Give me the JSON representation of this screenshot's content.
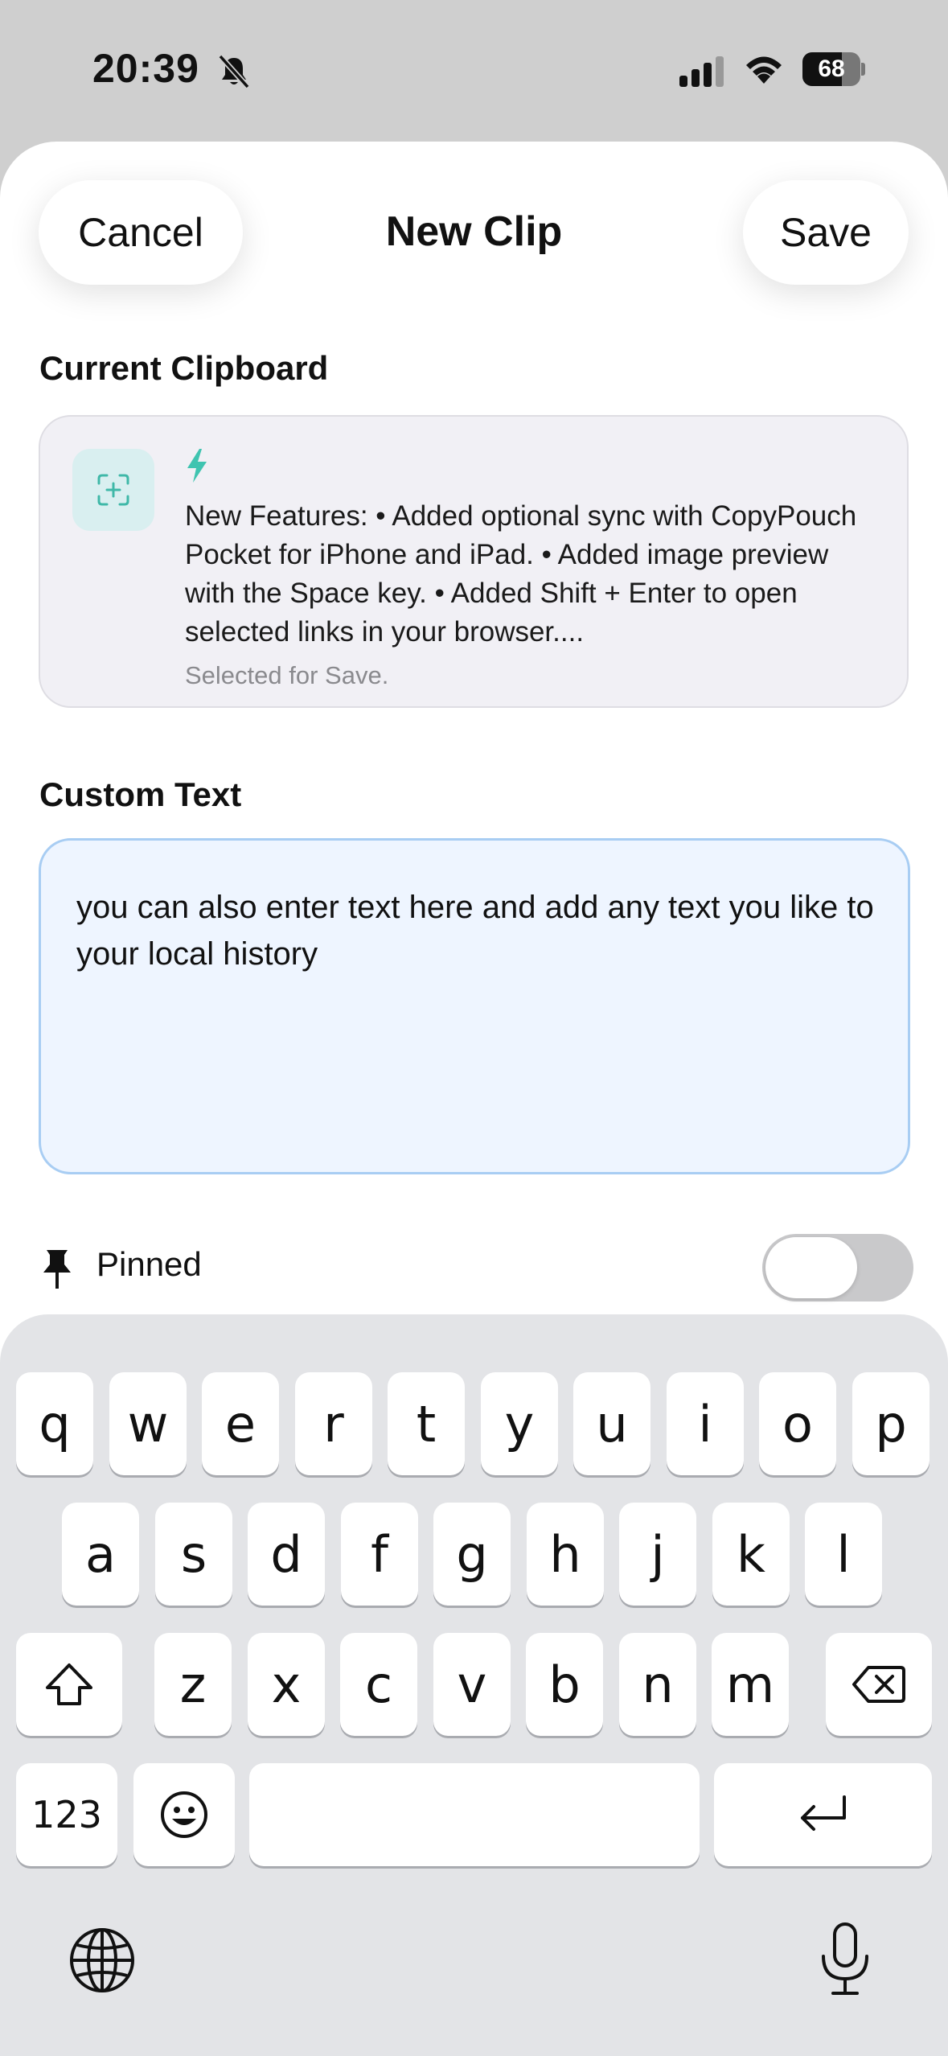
{
  "status_bar": {
    "time": "20:39",
    "battery": "68",
    "battery_level": 0.68,
    "icons": [
      "bell-slash-icon",
      "cellular-signal-icon",
      "wifi-icon",
      "battery-icon"
    ]
  },
  "header": {
    "cancel_label": "Cancel",
    "title": "New Clip",
    "save_label": "Save"
  },
  "clipboard": {
    "section_label": "Current Clipboard",
    "icon": "scan-add-icon",
    "type_icon": "bolt-icon",
    "text": "New Features: • Added optional sync with CopyPouch Pocket for iPhone and iPad. • Added image preview with the Space key. • Added Shift + Enter to open selected links in your browser....",
    "status": "Selected for Save."
  },
  "custom_text": {
    "section_label": "Custom Text",
    "value": "you can also enter text here and add any text you like to your local history"
  },
  "pinned": {
    "label": "Pinned",
    "on": false
  },
  "keyboard": {
    "row1": [
      "q",
      "w",
      "e",
      "r",
      "t",
      "y",
      "u",
      "i",
      "o",
      "p"
    ],
    "row2": [
      "a",
      "s",
      "d",
      "f",
      "g",
      "h",
      "j",
      "k",
      "l"
    ],
    "row3": [
      "z",
      "x",
      "c",
      "v",
      "b",
      "n",
      "m"
    ],
    "numbers_label": "123",
    "icons": [
      "shift-icon",
      "delete-icon",
      "emoji-icon",
      "return-icon",
      "globe-icon",
      "microphone-icon"
    ]
  },
  "colors": {
    "accent_teal": "#3fc4b0",
    "textarea_bg": "#eef5ff",
    "textarea_border": "#a8cdf3"
  }
}
